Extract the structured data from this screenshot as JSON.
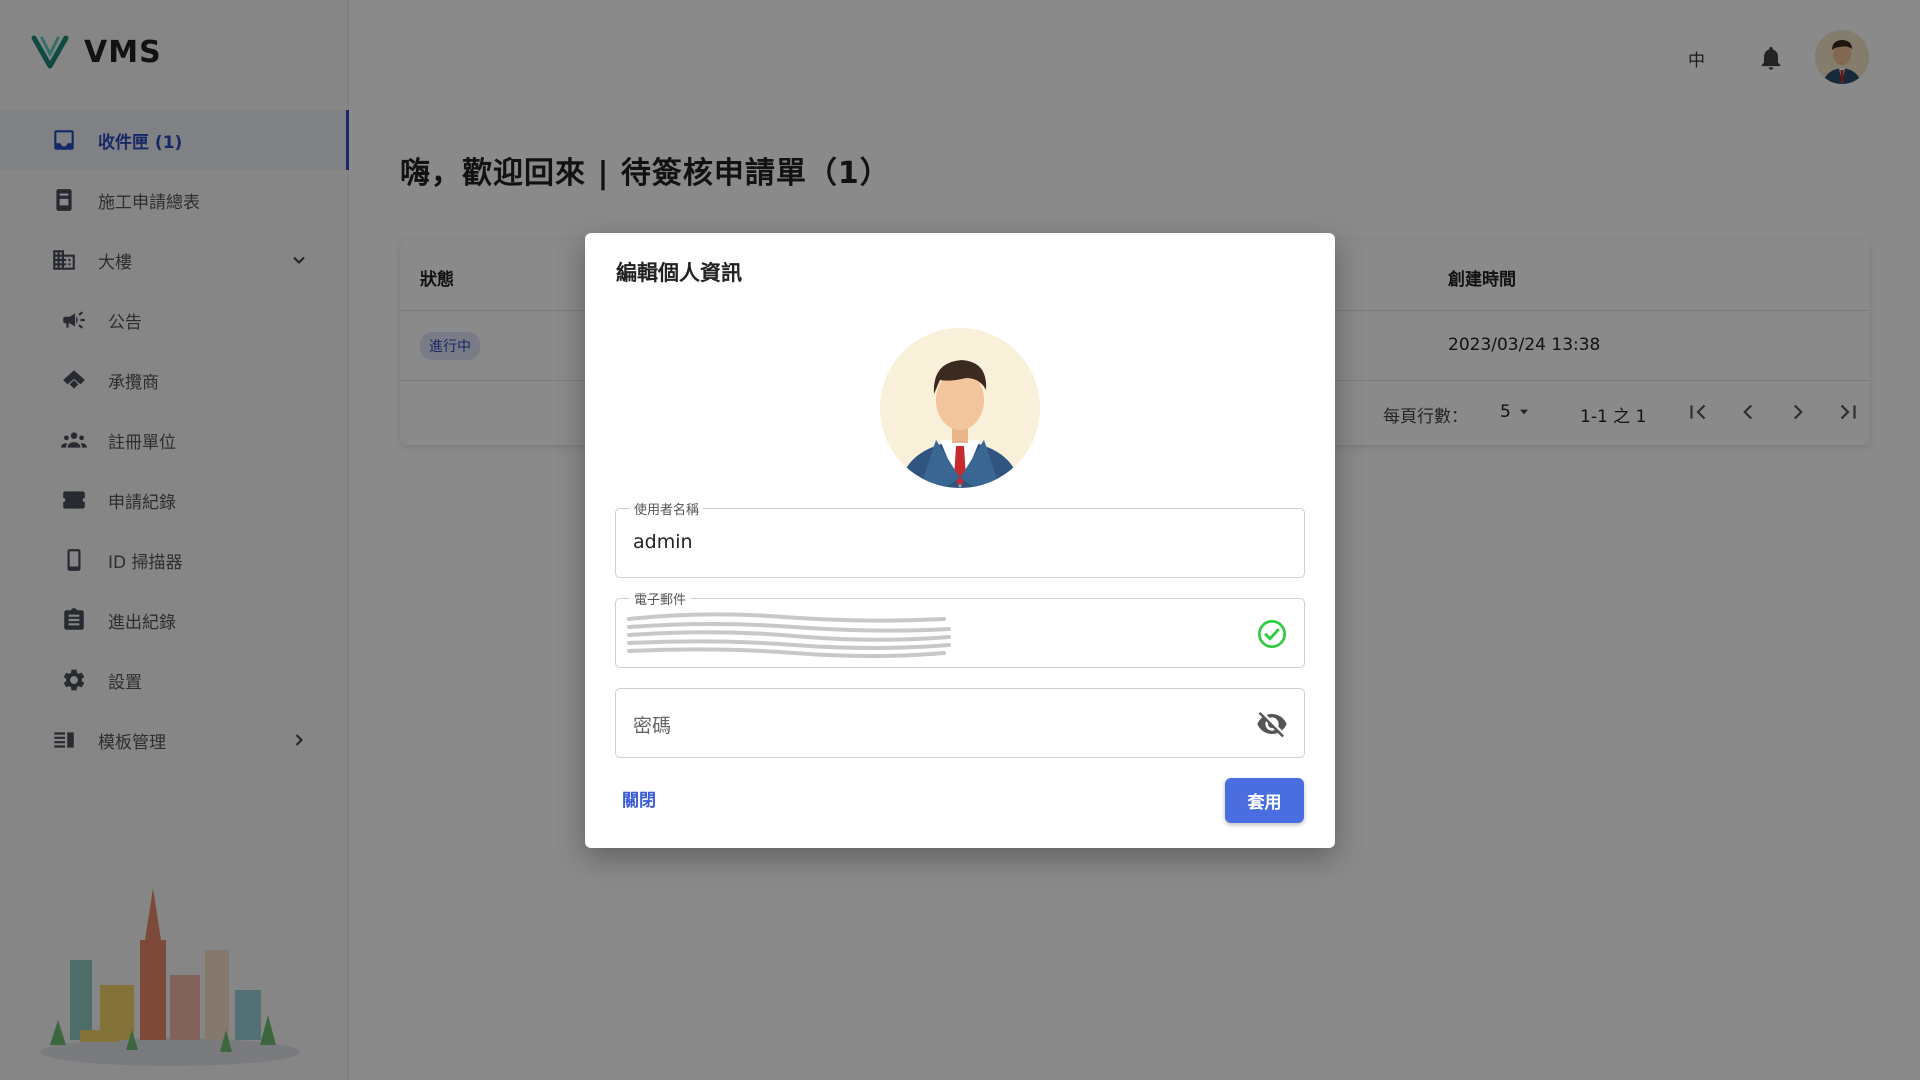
{
  "app": {
    "title": "VMS"
  },
  "sidebar": {
    "items": [
      {
        "label": "收件匣 (1)",
        "icon": "inbox-icon",
        "active": true
      },
      {
        "label": "施工申請總表",
        "icon": "document-icon"
      },
      {
        "label": "大樓",
        "icon": "building-icon",
        "expanded": true
      },
      {
        "label": "公告",
        "icon": "megaphone-icon"
      },
      {
        "label": "承攬商",
        "icon": "handshake-icon"
      },
      {
        "label": "註冊單位",
        "icon": "people-icon"
      },
      {
        "label": "申請紀錄",
        "icon": "ticket-icon"
      },
      {
        "label": "ID 掃描器",
        "icon": "phone-icon"
      },
      {
        "label": "進出紀錄",
        "icon": "clipboard-icon"
      },
      {
        "label": "設置",
        "icon": "gear-icon"
      },
      {
        "label": "模板管理",
        "icon": "template-icon",
        "expanded": false
      }
    ]
  },
  "header": {
    "language": "中"
  },
  "main": {
    "title": "嗨，歡迎回來 | 待簽核申請單（1）",
    "table": {
      "columns": {
        "status": "狀態",
        "created": "創建時間"
      },
      "rows": [
        {
          "status": "進行中",
          "created": "2023/03/24 13:38"
        }
      ],
      "pagination": {
        "rows_per_page_label": "每頁行數：",
        "rows_per_page": "5",
        "range": "1-1 之 1"
      }
    }
  },
  "dialog": {
    "title": "編輯個人資訊",
    "username_label": "使用者名稱",
    "username_value": "admin",
    "email_label": "電子郵件",
    "password_placeholder": "密碼",
    "close_label": "關閉",
    "apply_label": "套用"
  },
  "colors": {
    "accent": "#4a6ee0",
    "success": "#2ecc40",
    "brand": "#2b4bbf"
  }
}
